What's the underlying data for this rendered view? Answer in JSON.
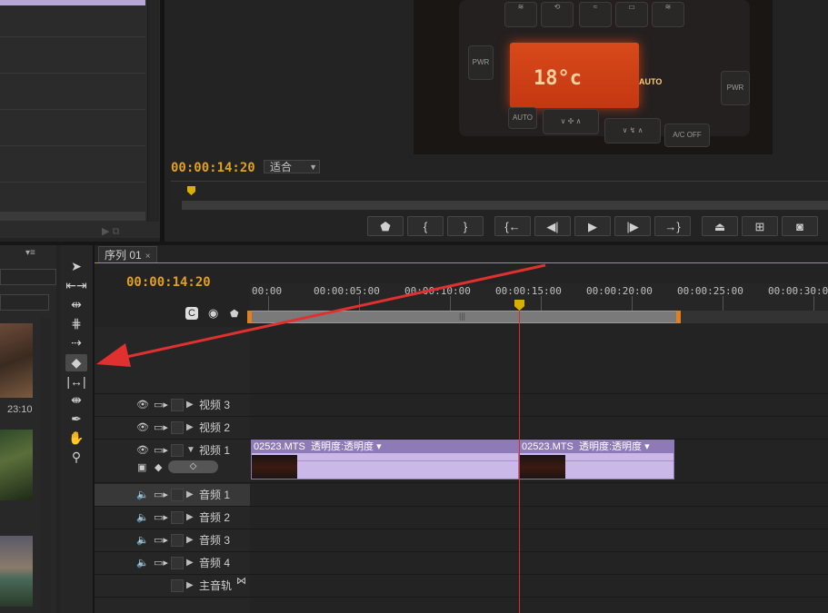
{
  "monitor": {
    "timecode": "00:00:14:20",
    "fit_label": "适合",
    "video_frame": {
      "lcd_temp": "18°c",
      "lcd_auto": "AUTO",
      "btn_pwr": "PWR",
      "btn_auto": "AUTO",
      "btn_acoff": "A/C OFF"
    },
    "transport": [
      "mark-in",
      "in-point",
      "out-point",
      "go-to-in",
      "step-back",
      "play",
      "step-forward",
      "go-to-out",
      "lift",
      "extract",
      "export-frame"
    ]
  },
  "bin": {
    "duration": "23:10"
  },
  "tools": [
    "selection",
    "track-select",
    "ripple-edit",
    "rolling-edit",
    "rate-stretch",
    "razor",
    "slip",
    "slide",
    "pen",
    "hand",
    "zoom"
  ],
  "timeline": {
    "tab_label": "序列 01",
    "tab_close": "×",
    "timecode": "00:00:14:20",
    "ruler_labels": [
      "00:00",
      "00:00:05:00",
      "00:00:10:00",
      "00:00:15:00",
      "00:00:20:00",
      "00:00:25:00",
      "00:00:30:00"
    ],
    "video_tracks": [
      "视频 3",
      "视频 2",
      "视频 1"
    ],
    "audio_tracks": [
      "音频 1",
      "音频 2",
      "音频 3",
      "音频 4"
    ],
    "master_track": "主音轨",
    "clips": [
      {
        "name": "02523.MTS",
        "effect": "透明度:透明度"
      },
      {
        "name": "02523.MTS",
        "effect": "透明度:透明度"
      }
    ]
  },
  "colors": {
    "timecode": "#e0a020",
    "clip_body": "#c9b8e8",
    "clip_head": "#8d7ab6",
    "playhead": "#d03030",
    "annotation_arrow": "#e03030"
  }
}
